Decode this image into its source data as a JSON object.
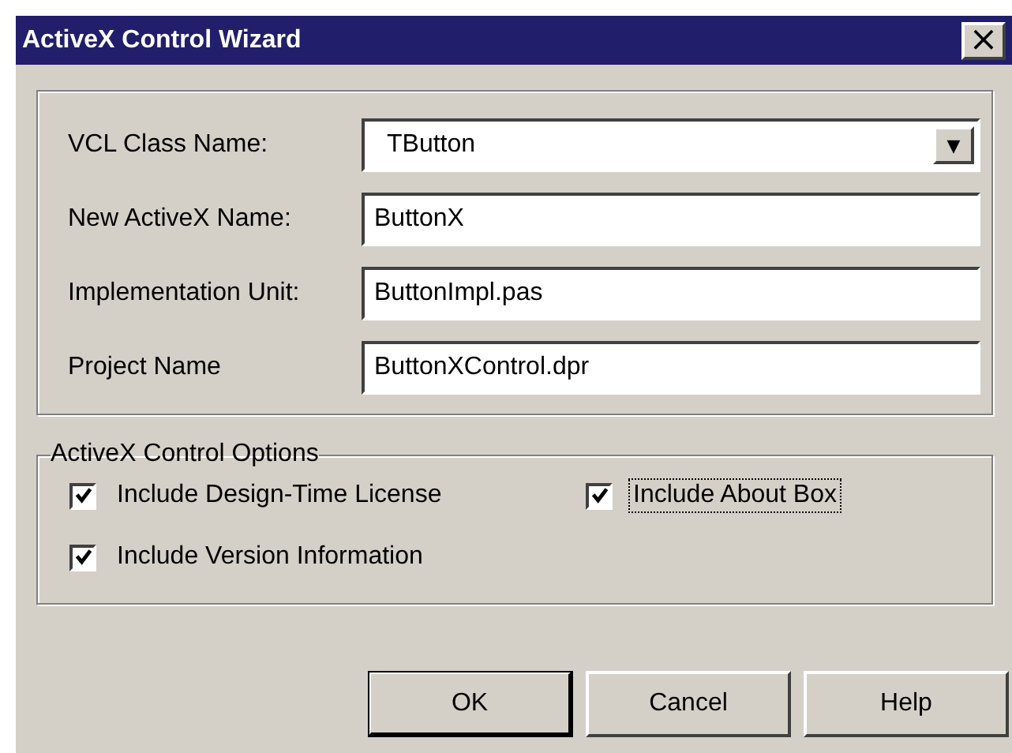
{
  "window": {
    "title": "ActiveX Control Wizard",
    "close": "×"
  },
  "fields": [
    {
      "kind": "dropdown",
      "label": "VCL Class Name:",
      "value": "TButton",
      "caret": "▼"
    },
    {
      "kind": "text",
      "label": "New ActiveX Name:",
      "value": "ButtonX"
    },
    {
      "kind": "text",
      "label": "Implementation Unit:",
      "value": "ButtonImpl.pas"
    },
    {
      "kind": "text",
      "label": "Project Name",
      "value": "ButtonXControl.dpr"
    }
  ],
  "options": {
    "title": "ActiveX Control Options",
    "items": [
      {
        "label": "Include Design-Time License",
        "checked": true,
        "focused": false
      },
      {
        "label": "Include About Box",
        "checked": true,
        "focused": true
      },
      {
        "label": "Include Version Information",
        "checked": true,
        "focused": false
      }
    ]
  },
  "buttons": [
    {
      "label": "OK",
      "default": true
    },
    {
      "label": "Cancel",
      "default": false
    },
    {
      "label": "Help",
      "default": false
    }
  ]
}
